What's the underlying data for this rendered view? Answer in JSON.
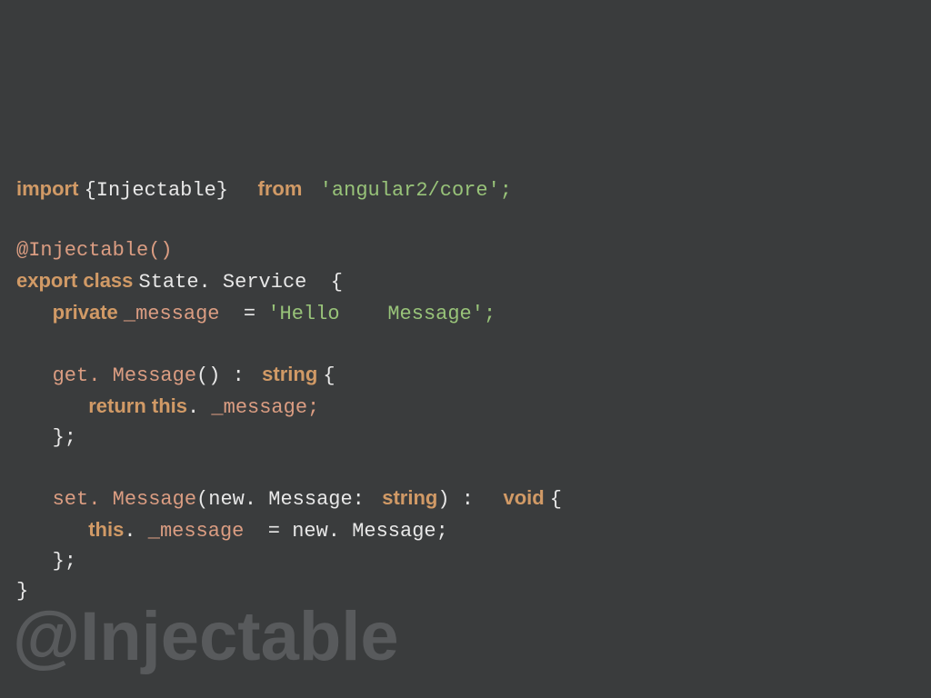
{
  "code": {
    "line1": {
      "import": "import ",
      "injectable": "{Injectable}  ",
      "from": " from ",
      "module": " 'angular2/core';"
    },
    "line3": {
      "decorator": "@Injectable()"
    },
    "line4": {
      "export_class": "export class ",
      "classname": "State. Service ",
      "brace": " {"
    },
    "line5": {
      "indent": "   ",
      "private": "private ",
      "field": "_message ",
      "eq": " = ",
      "str1": "'Hello   ",
      "str2": " Message';"
    },
    "line7": {
      "indent": "   ",
      "method": "get. Message",
      "parens": "() : ",
      "type": " string ",
      "brace": "{"
    },
    "line8": {
      "indent": "      ",
      "return_this": "return this",
      "dot": ". ",
      "field": "_message; "
    },
    "line9": {
      "indent": "   ",
      "close": "};"
    },
    "line11": {
      "indent": "   ",
      "method": "set. Message",
      "open": "(",
      "param": "new. Message: ",
      "type": " string",
      "close": ") :  ",
      "ret": " void ",
      "brace": "{"
    },
    "line12": {
      "indent": "      ",
      "this": "this",
      "dot": ". ",
      "field": "_message ",
      "eq": " = ",
      "val": "new. Message; "
    },
    "line13": {
      "indent": "   ",
      "close": "};"
    },
    "line14": {
      "close": "}"
    }
  },
  "heading": "@Injectable"
}
